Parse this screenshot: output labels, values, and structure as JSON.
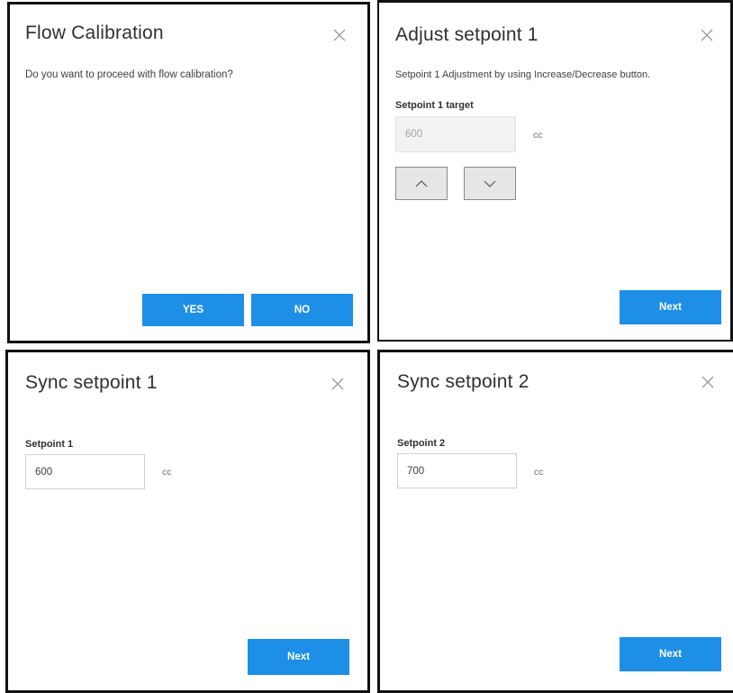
{
  "flow_calibration": {
    "title": "Flow Calibration",
    "message": "Do you want to proceed with flow calibration?",
    "yes_label": "YES",
    "no_label": "NO"
  },
  "adjust_setpoint_1": {
    "title": "Adjust setpoint 1",
    "description": "Setpoint 1 Adjustment by using Increase/Decrease button.",
    "field_label": "Setpoint 1 target",
    "value": "600",
    "unit": "cc",
    "next_label": "Next"
  },
  "sync_setpoint_1": {
    "title": "Sync setpoint 1",
    "field_label": "Setpoint 1",
    "value": "600",
    "unit": "cc",
    "next_label": "Next"
  },
  "sync_setpoint_2": {
    "title": "Sync setpoint 2",
    "field_label": "Setpoint 2",
    "value": "700",
    "unit": "cc",
    "next_label": "Next"
  },
  "colors": {
    "primary_button": "#1e8fe6",
    "panel_border": "#111111",
    "disabled_field": "#f2f2f2"
  }
}
